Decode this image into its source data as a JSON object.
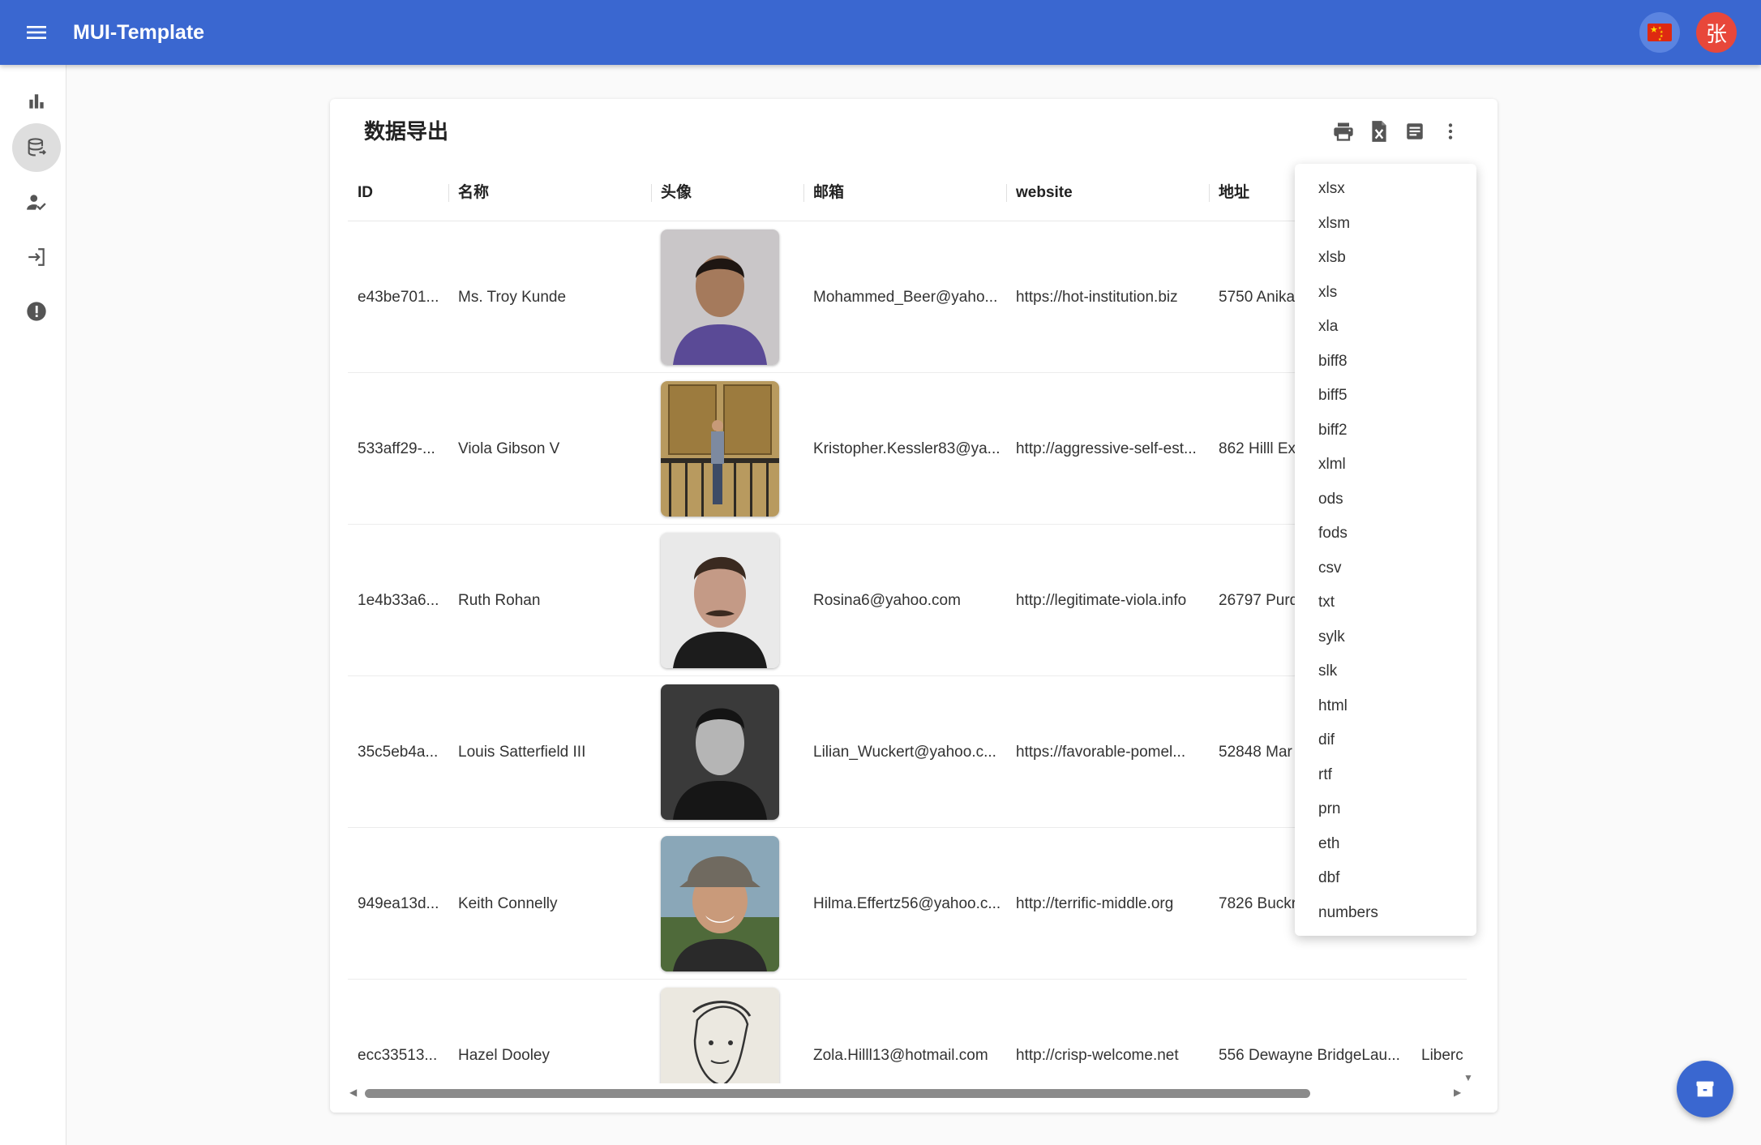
{
  "app": {
    "title": "MUI-Template",
    "avatar_text": "张"
  },
  "sidebar": {
    "items": [
      {
        "icon": "bar-chart-icon",
        "active": false
      },
      {
        "icon": "database-icon",
        "active": true
      },
      {
        "icon": "person-check-icon",
        "active": false
      },
      {
        "icon": "login-icon",
        "active": false
      },
      {
        "icon": "error-icon",
        "active": false
      }
    ]
  },
  "card": {
    "title": "数据导出",
    "toolbar": [
      "print-icon",
      "excel-icon",
      "document-icon",
      "more-vert-icon"
    ]
  },
  "table": {
    "headers": {
      "id": "ID",
      "name": "名称",
      "avatar": "头像",
      "email": "邮箱",
      "website": "website",
      "address": "地址"
    },
    "rows": [
      {
        "id": "e43be701...",
        "name": "Ms. Troy Kunde",
        "email": "Mohammed_Beer@yaho...",
        "website": "https://hot-institution.biz",
        "address": "5750 Anika",
        "extra": ""
      },
      {
        "id": "533aff29-...",
        "name": "Viola Gibson V",
        "email": "Kristopher.Kessler83@ya...",
        "website": "http://aggressive-self-est...",
        "address": "862 Hilll Ex",
        "extra": ""
      },
      {
        "id": "1e4b33a6...",
        "name": "Ruth Rohan",
        "email": "Rosina6@yahoo.com",
        "website": "http://legitimate-viola.info",
        "address": "26797 Purd",
        "extra": ""
      },
      {
        "id": "35c5eb4a...",
        "name": "Louis Satterfield III",
        "email": "Lilian_Wuckert@yahoo.c...",
        "website": "https://favorable-pomel...",
        "address": "52848 Mar",
        "extra": ""
      },
      {
        "id": "949ea13d...",
        "name": "Keith Connelly",
        "email": "Hilma.Effertz56@yahoo.c...",
        "website": "http://terrific-middle.org",
        "address": "7826 Buckr",
        "extra": ""
      },
      {
        "id": "ecc33513...",
        "name": "Hazel Dooley",
        "email": "Zola.Hilll13@hotmail.com",
        "website": "http://crisp-welcome.net",
        "address": "556 Dewayne BridgeLau...",
        "extra": "Liberc"
      }
    ]
  },
  "export_menu": {
    "options": [
      "xlsx",
      "xlsm",
      "xlsb",
      "xls",
      "xla",
      "biff8",
      "biff5",
      "biff2",
      "xlml",
      "ods",
      "fods",
      "csv",
      "txt",
      "sylk",
      "slk",
      "html",
      "dif",
      "rtf",
      "prn",
      "eth",
      "dbf",
      "numbers"
    ]
  },
  "colors": {
    "primary": "#3a67d0",
    "avatar_bg": "#e8473a"
  }
}
